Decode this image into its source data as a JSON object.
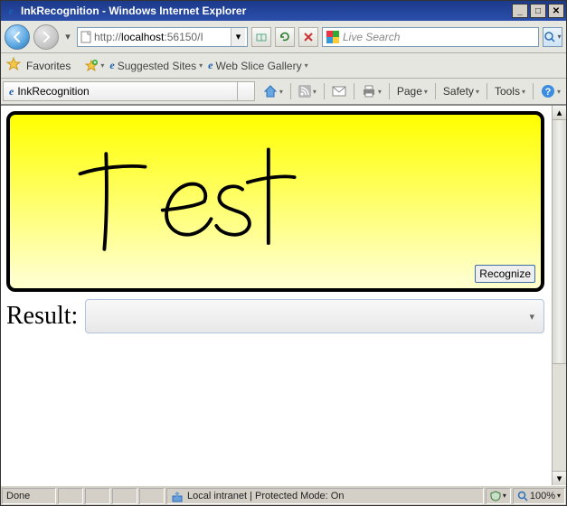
{
  "window": {
    "title": "InkRecognition - Windows Internet Explorer"
  },
  "address": {
    "prefix": "http://",
    "host": "localhost",
    "rest": ":56150/I"
  },
  "search": {
    "placeholder": "Live Search"
  },
  "favorites": {
    "label": "Favorites",
    "suggested": "Suggested Sites",
    "webslice": "Web Slice Gallery"
  },
  "tab": {
    "title": "InkRecognition"
  },
  "commands": {
    "page": "Page",
    "safety": "Safety",
    "tools": "Tools"
  },
  "ink": {
    "recognize_label": "Recognize"
  },
  "result": {
    "label": "Result:",
    "value": ""
  },
  "status": {
    "done": "Done",
    "zone": "Local intranet | Protected Mode: On",
    "zoom": "100%"
  }
}
